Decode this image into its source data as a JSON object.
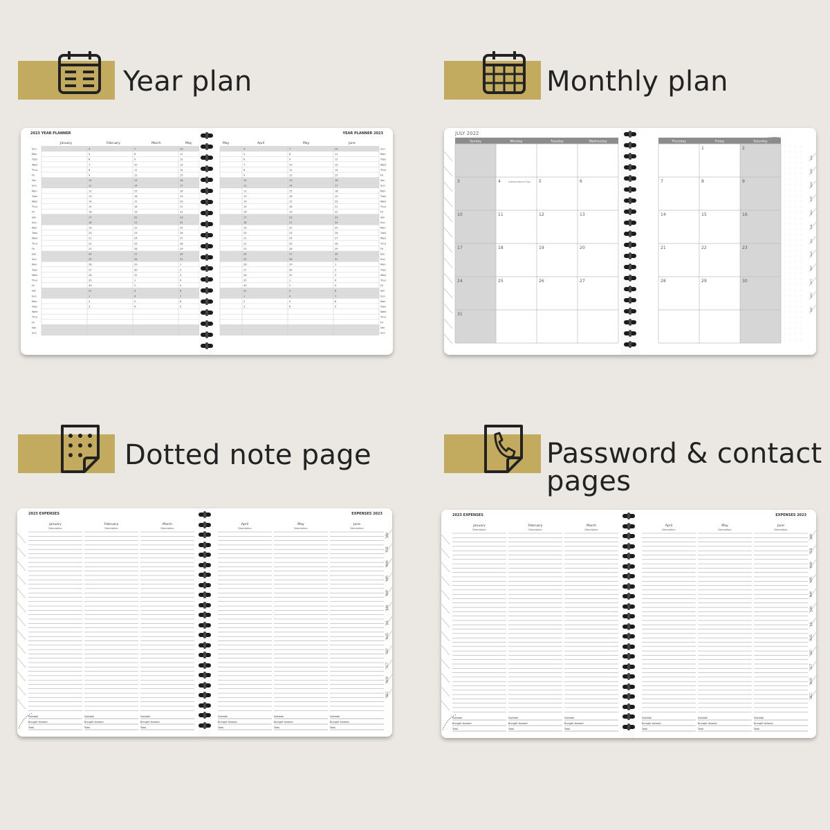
{
  "colors": {
    "background": "#ebe8e3",
    "gold": "#c2ab5e",
    "ink": "#222222",
    "shade": "#d6d6d6",
    "header_gray": "#8c8c8c"
  },
  "sections": {
    "year": {
      "title": "Year plan",
      "icon": "calendar-list-icon"
    },
    "monthly": {
      "title": "Monthly plan",
      "icon": "calendar-grid-icon"
    },
    "dotted": {
      "title": "Dotted note page",
      "icon": "dotted-page-icon"
    },
    "password": {
      "title_line1": "Password & contact",
      "title_line2": "pages",
      "icon": "phone-page-icon"
    }
  },
  "year_planner": {
    "left_title": "2023 YEAR PLANNER",
    "right_title": "YEAR PLANNER 2023",
    "left_months": [
      "January",
      "February",
      "March",
      "May"
    ],
    "right_months": [
      "May",
      "April",
      "May",
      "June"
    ]
  },
  "monthly_planner": {
    "month_title": "JULY 2022",
    "notes_label": "NOTES",
    "left_days": [
      "Sunday",
      "Monday",
      "Tuesday",
      "Wednesday"
    ],
    "right_days": [
      "Thursday",
      "Friday",
      "Saturday"
    ],
    "holiday_text": "Independence Day",
    "tabs": [
      "JAN",
      "FEB",
      "MAR",
      "APR",
      "MAY",
      "JUN",
      "JUL",
      "AUG",
      "SEP",
      "OCT",
      "NOV",
      "DEC"
    ]
  },
  "expenses": {
    "left_title": "2023 EXPENSES",
    "right_title": "EXPENSES 2023",
    "left_months": [
      "January",
      "February",
      "March"
    ],
    "right_months": [
      "April",
      "May",
      "June"
    ],
    "description_label": "Description",
    "footer_labels": [
      "Subtotal",
      "Brought forward",
      "Total"
    ],
    "tabs": [
      "JAN",
      "FEB",
      "MAR",
      "APR",
      "MAY",
      "JUN",
      "JUL",
      "AUG",
      "SEP",
      "OCT",
      "NOV",
      "DEC"
    ]
  }
}
